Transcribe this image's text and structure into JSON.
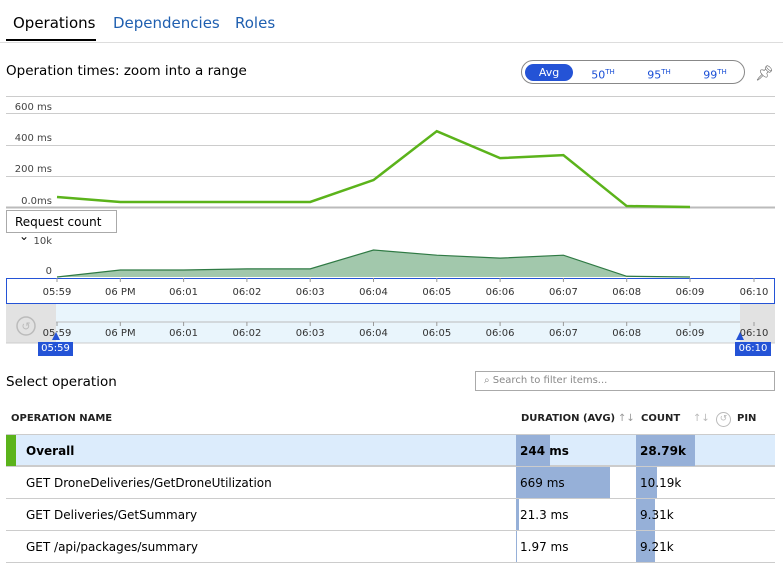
{
  "tabs": [
    {
      "label": "Operations",
      "active": true
    },
    {
      "label": "Dependencies"
    },
    {
      "label": "Roles"
    }
  ],
  "chart_title": "Operation times: zoom into a range",
  "percentiles": {
    "options": [
      {
        "label": "Avg",
        "sup": ""
      },
      {
        "label": "50",
        "sup": "TH"
      },
      {
        "label": "95",
        "sup": "TH"
      },
      {
        "label": "99",
        "sup": "TH"
      }
    ],
    "selected": "Avg"
  },
  "pin_icon": "pin-icon",
  "colors": {
    "duration_line": "#5bb31b",
    "count_fill": "#a2c8ac",
    "count_line": "#2f7a44",
    "accent": "#2453d6",
    "bar": "#96b0d8",
    "overall_marker": "#5bb31b"
  },
  "chart_data": [
    {
      "type": "line",
      "ylabels": [
        "600 ms",
        "400 ms",
        "200 ms",
        "0.0ms"
      ],
      "ylim": [
        0,
        600
      ],
      "x": [
        "05:59",
        "06 PM",
        "06:01",
        "06:02",
        "06:03",
        "06:04",
        "06:05",
        "06:06",
        "06:07",
        "06:08",
        "06:09"
      ],
      "values": [
        64,
        32,
        32,
        32,
        32,
        172,
        484,
        312,
        331,
        6,
        0
      ]
    },
    {
      "type": "area",
      "ylabels": [
        "10k",
        "0"
      ],
      "ylim": [
        0,
        10000
      ],
      "x": [
        "05:59",
        "06 PM",
        "06:01",
        "06:02",
        "06:03",
        "06:04",
        "06:05",
        "06:06",
        "06:07",
        "06:08",
        "06:09"
      ],
      "values": [
        0,
        1900,
        1900,
        2200,
        2200,
        7300,
        5900,
        5100,
        5900,
        200,
        0
      ]
    }
  ],
  "metric_dropdown": "Request count",
  "time_ticks": [
    "05:59",
    "06 PM",
    "06:01",
    "06:02",
    "06:03",
    "06:04",
    "06:05",
    "06:06",
    "06:07",
    "06:08",
    "06:09",
    "06:10"
  ],
  "range": {
    "start": "05:59",
    "end": "06:10"
  },
  "select_title": "Select operation",
  "search_placeholder": "Search to filter items...",
  "table": {
    "headers": {
      "name": "OPERATION NAME",
      "duration": "DURATION (AVG)",
      "count": "COUNT",
      "pin": "PIN"
    },
    "rows": [
      {
        "name": "Overall",
        "duration": "244 ms",
        "duration_ms": 244,
        "count": "28.79k",
        "count_k": 28.79,
        "selected": true
      },
      {
        "name": "GET DroneDeliveries/GetDroneUtilization",
        "duration": "669 ms",
        "duration_ms": 669,
        "count": "10.19k",
        "count_k": 10.19
      },
      {
        "name": "GET Deliveries/GetSummary",
        "duration": "21.3 ms",
        "duration_ms": 21.3,
        "count": "9.31k",
        "count_k": 9.31
      },
      {
        "name": "GET /api/packages/summary",
        "duration": "1.97 ms",
        "duration_ms": 1.97,
        "count": "9.21k",
        "count_k": 9.21
      }
    ]
  }
}
